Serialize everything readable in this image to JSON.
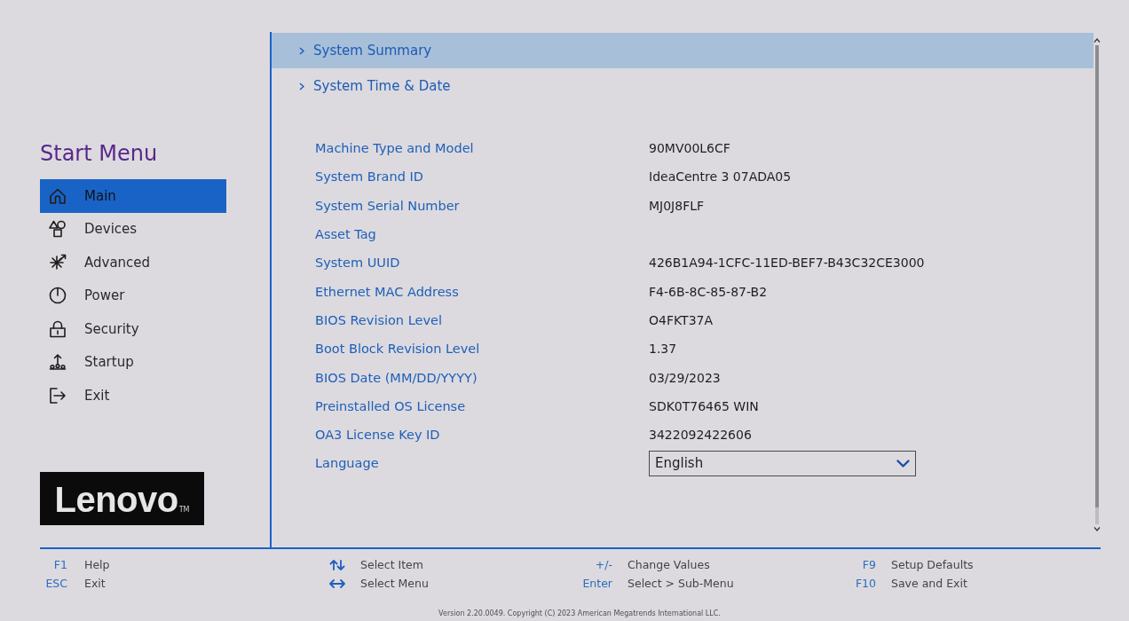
{
  "sidebar": {
    "title": "Start Menu",
    "items": [
      {
        "label": "Main",
        "selected": true
      },
      {
        "label": "Devices",
        "selected": false
      },
      {
        "label": "Advanced",
        "selected": false
      },
      {
        "label": "Power",
        "selected": false
      },
      {
        "label": "Security",
        "selected": false
      },
      {
        "label": "Startup",
        "selected": false
      },
      {
        "label": "Exit",
        "selected": false
      }
    ],
    "logo": {
      "text": "Lenovo",
      "mark": "TM"
    }
  },
  "main": {
    "links": [
      {
        "label": "System Summary",
        "selected": true
      },
      {
        "label": "System Time & Date",
        "selected": false
      }
    ],
    "fields": [
      {
        "kind": "text",
        "label": "Machine Type and Model",
        "value": "90MV00L6CF"
      },
      {
        "kind": "text",
        "label": "System Brand ID",
        "value": "IdeaCentre 3 07ADA05"
      },
      {
        "kind": "text",
        "label": "System Serial Number",
        "value": "MJ0J8FLF"
      },
      {
        "kind": "text",
        "label": "Asset Tag"
      },
      {
        "kind": "text",
        "label": "System UUID",
        "value": "426B1A94-1CFC-11ED-BEF7-B43C32CE3000"
      },
      {
        "kind": "text",
        "label": "Ethernet MAC Address",
        "value": "F4-6B-8C-85-87-B2"
      },
      {
        "kind": "text",
        "label": "BIOS Revision Level",
        "value": "O4FKT37A"
      },
      {
        "kind": "text",
        "label": "Boot Block Revision Level",
        "value": "1.37"
      },
      {
        "kind": "text",
        "label": "BIOS Date (MM/DD/YYYY)",
        "value": "03/29/2023"
      },
      {
        "kind": "text",
        "label": "Preinstalled OS License",
        "value": "SDK0T76465 WIN"
      },
      {
        "kind": "text",
        "label": "OA3 License Key ID",
        "value": "3422092422606"
      },
      {
        "kind": "dropdown",
        "label": "Language",
        "value": "English"
      }
    ]
  },
  "footer": {
    "columns": [
      {
        "items": [
          {
            "kind": "key",
            "key": "F1",
            "action": "Help"
          },
          {
            "kind": "key",
            "key": "ESC",
            "action": "Exit"
          }
        ]
      },
      {
        "items": [
          {
            "kind": "updown",
            "action": "Select Item"
          },
          {
            "kind": "leftright",
            "action": "Select Menu"
          }
        ]
      },
      {
        "items": [
          {
            "kind": "key",
            "key": "+/-",
            "action": "Change Values"
          },
          {
            "kind": "key",
            "key": "Enter",
            "action": "Select > Sub-Menu"
          }
        ]
      },
      {
        "items": [
          {
            "kind": "key",
            "key": "F9",
            "action": "Setup Defaults"
          },
          {
            "kind": "key",
            "key": "F10",
            "action": "Save and Exit"
          }
        ]
      }
    ],
    "version": "Version 2.20.0049. Copyright (C) 2023 American Megatrends International LLC."
  }
}
